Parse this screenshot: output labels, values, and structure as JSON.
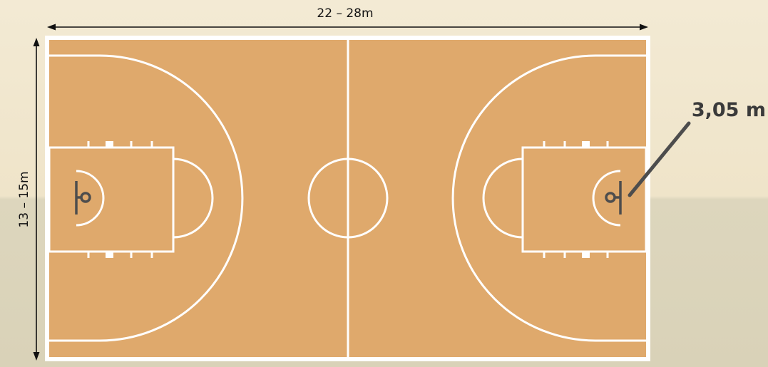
{
  "dimensions": {
    "width_label": "22 – 28m",
    "height_label": "13 – 15m",
    "hoop_height_label": "3,05 m"
  },
  "colors": {
    "court_floor": "#dfa96c",
    "court_lines": "#ffffff",
    "arrows": "#111111",
    "hoop_marker": "#4d4d4d"
  }
}
